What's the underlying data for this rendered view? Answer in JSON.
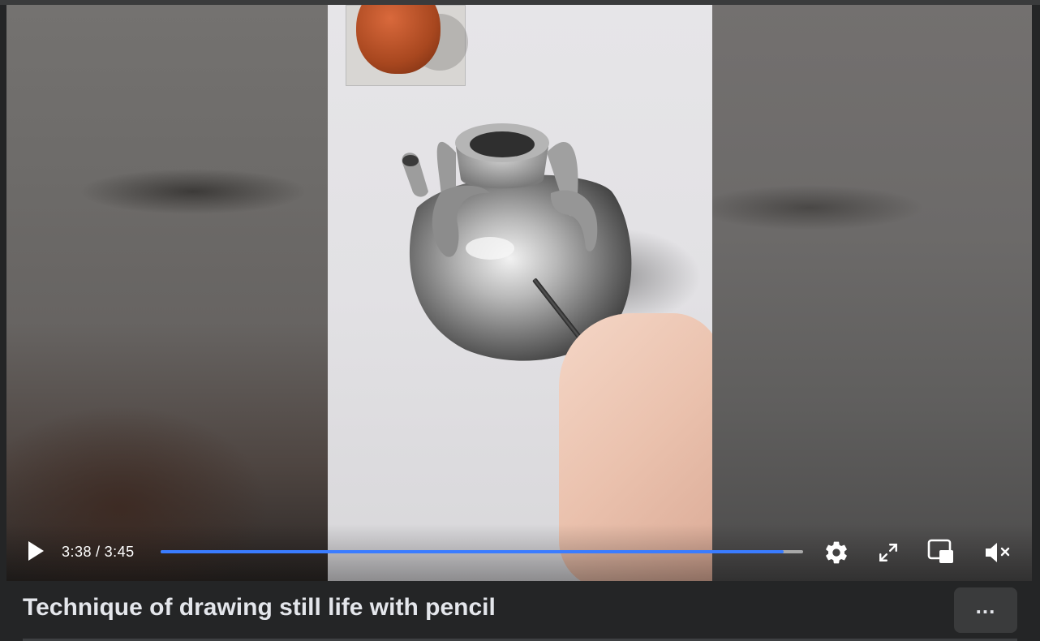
{
  "player": {
    "current_time": "3:38",
    "separator": "/",
    "duration": "3:45",
    "progress_fraction": 0.97,
    "accent_color": "#3a7cff",
    "icons": {
      "play": "play-icon",
      "settings": "gear-icon",
      "fullscreen": "fullscreen-icon",
      "pip": "picture-in-picture-icon",
      "mute": "volume-muted-icon"
    }
  },
  "video": {
    "title": "Technique of drawing still life with pencil"
  },
  "actions": {
    "more_label": "...",
    "more_icon": "ellipsis-icon"
  }
}
